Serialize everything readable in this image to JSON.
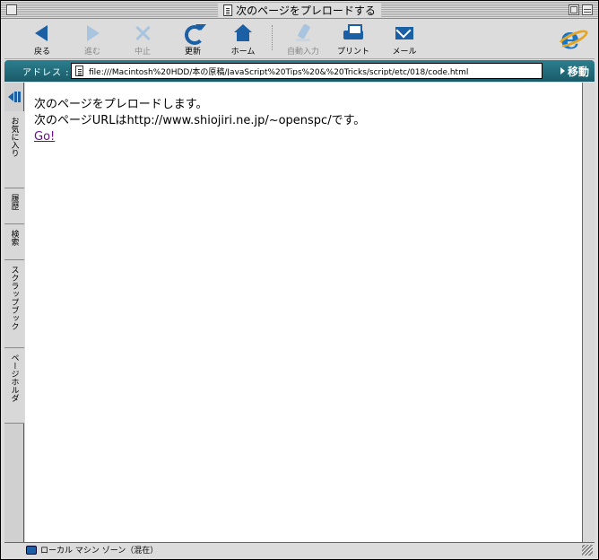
{
  "window": {
    "title": "次のページをプレロードする"
  },
  "toolbar": {
    "back": "戻る",
    "forward": "進む",
    "stop": "中止",
    "refresh": "更新",
    "home": "ホーム",
    "autofill": "自動入力",
    "print": "プリント",
    "mail": "メール"
  },
  "address": {
    "label": "アドレス :",
    "url": "file:///Macintosh%20HDD/本の原稿/JavaScript%20Tips%20&%20Tricks/script/etc/018/code.html",
    "go_label": "移動"
  },
  "sidebar": {
    "tabs": [
      {
        "label": "お気に入り"
      },
      {
        "label": "履歴"
      },
      {
        "label": "検索"
      },
      {
        "label": "スクラップブック"
      },
      {
        "label": "ページホルダ"
      }
    ]
  },
  "page": {
    "line1": "次のページをプレロードします。",
    "line2": "次のページURLはhttp://www.shiojiri.ne.jp/~openspc/です。",
    "link": "Go!"
  },
  "status": {
    "zone": "ローカル マシン ゾーン（混在）"
  },
  "colors": {
    "accent": "#1b5fa5",
    "addressbar": "#2c7f8e",
    "link": "#6a0f8e"
  }
}
